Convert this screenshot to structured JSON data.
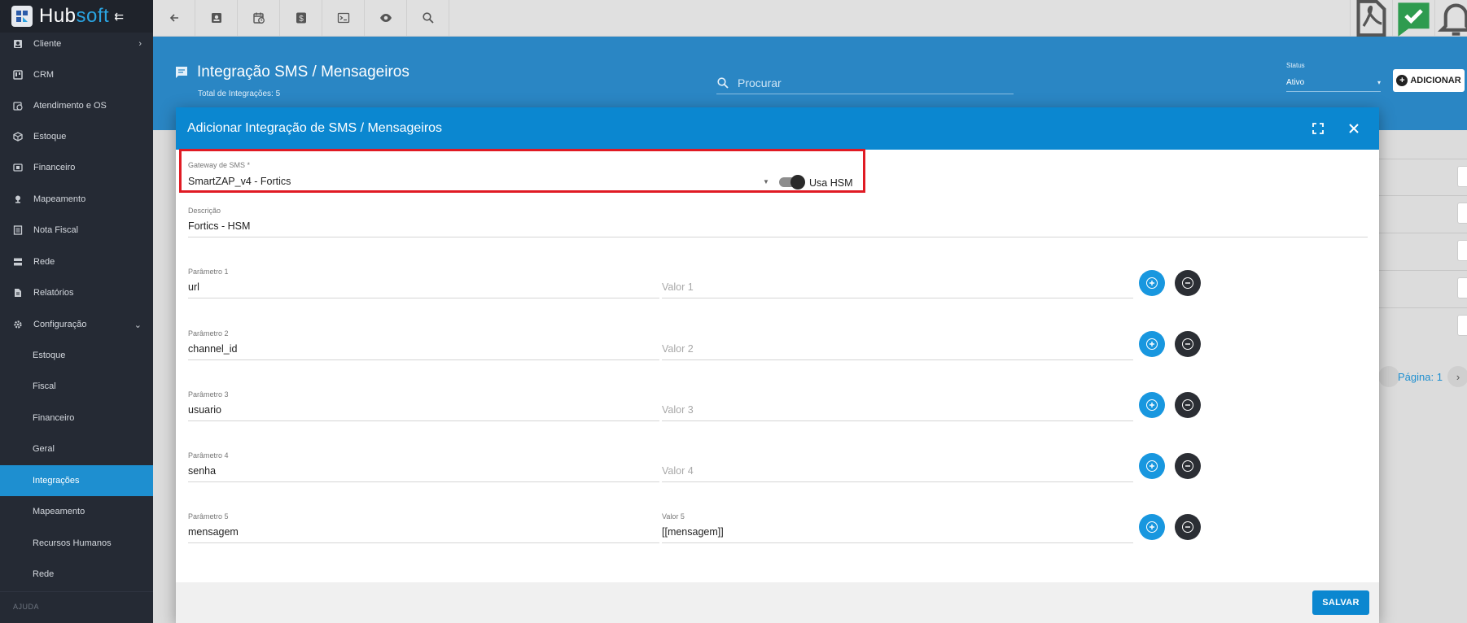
{
  "app": {
    "brand_main": "Hub",
    "brand_accent": "soft",
    "collapse_icon": "collapse-arrow-icon"
  },
  "sidebar": {
    "items": [
      {
        "label": "Cliente",
        "icon": "user-card-icon",
        "chevron": "›"
      },
      {
        "label": "CRM",
        "icon": "board-icon"
      },
      {
        "label": "Atendimento e OS",
        "icon": "calendar-clock-icon"
      },
      {
        "label": "Estoque",
        "icon": "box-icon"
      },
      {
        "label": "Financeiro",
        "icon": "money-icon"
      },
      {
        "label": "Mapeamento",
        "icon": "map-pin-icon"
      },
      {
        "label": "Nota Fiscal",
        "icon": "receipt-icon"
      },
      {
        "label": "Rede",
        "icon": "server-icon"
      },
      {
        "label": "Relatórios",
        "icon": "document-icon"
      },
      {
        "label": "Configuração",
        "icon": "gear-icon",
        "chevron": "⌄"
      }
    ],
    "subitems": [
      {
        "label": "Estoque"
      },
      {
        "label": "Fiscal"
      },
      {
        "label": "Financeiro"
      },
      {
        "label": "Geral"
      },
      {
        "label": "Integrações",
        "active": true
      },
      {
        "label": "Mapeamento"
      },
      {
        "label": "Recursos Humanos"
      },
      {
        "label": "Rede"
      }
    ],
    "section_help": "AJUDA"
  },
  "topbar": {
    "buttons": [
      "back-arrow-icon",
      "contact-card-icon",
      "calendar-clock-icon",
      "dollar-icon",
      "terminal-icon",
      "eye-icon",
      "search-icon"
    ],
    "right_buttons": [
      "pdf-icon",
      "check-chat-icon",
      "bell-icon"
    ]
  },
  "page": {
    "title": "Integração SMS / Mensageiros",
    "subtitle": "Total de Integrações: 5",
    "search_placeholder": "Procurar",
    "status_label": "Status",
    "status_value": "Ativo",
    "add_label": "ADICIONAR",
    "pagination_label": "Página: 1"
  },
  "modal": {
    "title": "Adicionar Integração de SMS / Mensageiros",
    "gateway_label": "Gateway de SMS",
    "gateway_required": "*",
    "gateway_value": "SmartZAP_v4 - Fortics",
    "hsm_label": "Usa HSM",
    "hsm_enabled": true,
    "description_label": "Descrição",
    "description_value": "Fortics - HSM",
    "params": [
      {
        "label": "Parâmetro 1",
        "value": "url",
        "value_label": "",
        "value_placeholder": "Valor 1",
        "value_value": ""
      },
      {
        "label": "Parâmetro 2",
        "value": "channel_id",
        "value_label": "",
        "value_placeholder": "Valor 2",
        "value_value": ""
      },
      {
        "label": "Parâmetro 3",
        "value": "usuario",
        "value_label": "",
        "value_placeholder": "Valor 3",
        "value_value": ""
      },
      {
        "label": "Parâmetro 4",
        "value": "senha",
        "value_label": "",
        "value_placeholder": "Valor 4",
        "value_value": ""
      },
      {
        "label": "Parâmetro 5",
        "value": "mensagem",
        "value_label": "Valor 5",
        "value_placeholder": "",
        "value_value": "[[mensagem]]"
      }
    ],
    "save_label": "SALVAR"
  },
  "colors": {
    "sidebar_bg": "#252a34",
    "active_item": "#1e8fd0",
    "header_blue": "#2a86c4",
    "modal_header": "#0b87d0",
    "highlight_border": "#e01b24"
  }
}
